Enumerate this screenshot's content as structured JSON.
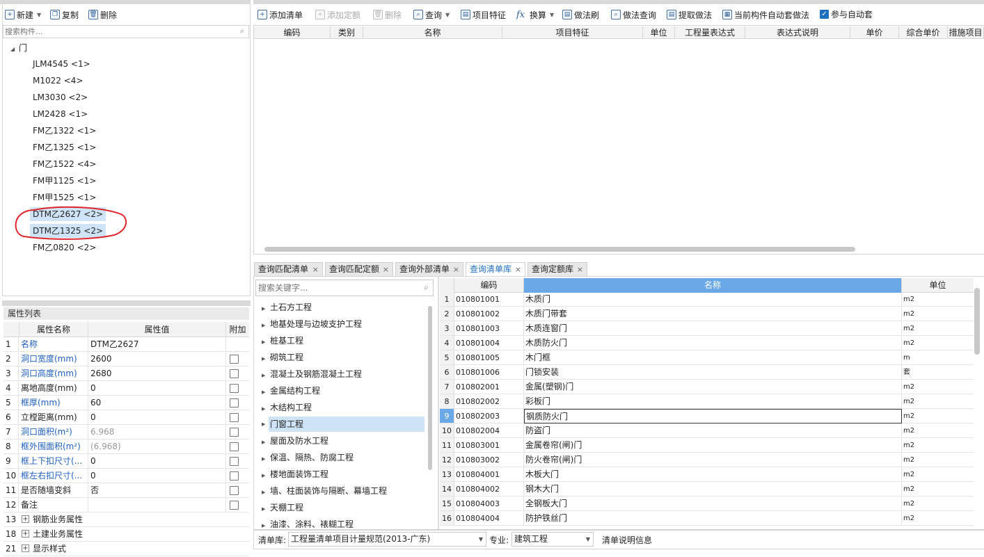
{
  "left_toolbar": {
    "new": "新建",
    "copy": "复制",
    "delete": "删除"
  },
  "search_component": {
    "placeholder": "搜索构件..."
  },
  "tree": {
    "root": "门",
    "items": [
      "JLM4545 <1>",
      "M1022 <4>",
      "LM3030 <2>",
      "LM2428 <1>",
      "FM乙1322 <1>",
      "FM乙1325 <1>",
      "FM乙1522 <4>",
      "FM甲1125 <1>",
      "FM甲1525 <1>",
      "DTM乙2627 <2>",
      "DTM乙1325 <2>",
      "FM乙0820 <2>"
    ]
  },
  "props": {
    "title": "属性列表",
    "headers": [
      "属性名称",
      "属性值",
      "附加"
    ],
    "rows": [
      {
        "n": "1",
        "name": "名称",
        "val": "DTM乙2627"
      },
      {
        "n": "2",
        "name": "洞口宽度(mm)",
        "val": "2600"
      },
      {
        "n": "3",
        "name": "洞口高度(mm)",
        "val": "2680"
      },
      {
        "n": "4",
        "name": "离地高度(mm)",
        "val": "0"
      },
      {
        "n": "5",
        "name": "框厚(mm)",
        "val": "60"
      },
      {
        "n": "6",
        "name": "立樘距离(mm)",
        "val": "0"
      },
      {
        "n": "7",
        "name": "洞口面积(m²)",
        "val": "6.968"
      },
      {
        "n": "8",
        "name": "框外围面积(m²)",
        "val": "(6.968)"
      },
      {
        "n": "9",
        "name": "框上下扣尺寸(...",
        "val": "0"
      },
      {
        "n": "10",
        "name": "框左右扣尺寸(...",
        "val": "0"
      },
      {
        "n": "11",
        "name": "是否随墙变斜",
        "val": "否"
      },
      {
        "n": "12",
        "name": "备注",
        "val": ""
      },
      {
        "n": "13",
        "name": "钢筋业务属性",
        "val": ""
      },
      {
        "n": "18",
        "name": "土建业务属性",
        "val": ""
      },
      {
        "n": "21",
        "name": "显示样式",
        "val": ""
      }
    ]
  },
  "right_toolbar": {
    "add_list": "添加清单",
    "add_quota": "添加定额",
    "delete": "删除",
    "query": "查询",
    "item_feature": "项目特征",
    "convert": "换算",
    "method_brush": "做法刷",
    "method_query": "做法查询",
    "extract_method": "提取做法",
    "auto_apply": "当前构件自动套做法",
    "join_auto": "参与自动套"
  },
  "main_grid": {
    "headers": [
      "编码",
      "类别",
      "名称",
      "项目特征",
      "单位",
      "工程量表达式",
      "表达式说明",
      "单价",
      "综合单价",
      "措施项目"
    ]
  },
  "tabs": [
    "查询匹配清单",
    "查询匹配定额",
    "查询外部清单",
    "查询清单库",
    "查询定额库"
  ],
  "search_keyword": {
    "placeholder": "搜索关键字..."
  },
  "categories": [
    "土石方工程",
    "地基处理与边坡支护工程",
    "桩基工程",
    "砌筑工程",
    "混凝土及钢筋混凝土工程",
    "金属结构工程",
    "木结构工程",
    "门窗工程",
    "屋面及防水工程",
    "保温、隔热、防腐工程",
    "楼地面装饰工程",
    "墙、柱面装饰与隔断、幕墙工程",
    "天棚工程",
    "油漆、涂料、裱糊工程"
  ],
  "list_grid": {
    "headers": [
      "编码",
      "名称",
      "单位"
    ],
    "rows": [
      {
        "n": "1",
        "code": "010801001",
        "name": "木质门",
        "unit": "m2"
      },
      {
        "n": "2",
        "code": "010801002",
        "name": "木质门带套",
        "unit": "m2"
      },
      {
        "n": "3",
        "code": "010801003",
        "name": "木质连窗门",
        "unit": "m2"
      },
      {
        "n": "4",
        "code": "010801004",
        "name": "木质防火门",
        "unit": "m2"
      },
      {
        "n": "5",
        "code": "010801005",
        "name": "木门框",
        "unit": "m"
      },
      {
        "n": "6",
        "code": "010801006",
        "name": "门锁安装",
        "unit": "套"
      },
      {
        "n": "7",
        "code": "010802001",
        "name": "金属(塑钢)门",
        "unit": "m2"
      },
      {
        "n": "8",
        "code": "010802002",
        "name": "彩板门",
        "unit": "m2"
      },
      {
        "n": "9",
        "code": "010802003",
        "name": "钢质防火门",
        "unit": "m2"
      },
      {
        "n": "10",
        "code": "010802004",
        "name": "防盗门",
        "unit": "m2"
      },
      {
        "n": "11",
        "code": "010803001",
        "name": "金属卷帘(闸)门",
        "unit": "m2"
      },
      {
        "n": "12",
        "code": "010803002",
        "name": "防火卷帘(闸)门",
        "unit": "m2"
      },
      {
        "n": "13",
        "code": "010804001",
        "name": "木板大门",
        "unit": "m2"
      },
      {
        "n": "14",
        "code": "010804002",
        "name": "钢木大门",
        "unit": "m2"
      },
      {
        "n": "15",
        "code": "010804003",
        "name": "全钢板大门",
        "unit": "m2"
      },
      {
        "n": "16",
        "code": "010804004",
        "name": "防护铁丝门",
        "unit": "m2"
      }
    ]
  },
  "footer": {
    "lib_label": "清单库:",
    "lib_value": "工程量清单项目计量规范(2013-广东)",
    "major_label": "专业:",
    "major_value": "建筑工程",
    "info": "清单说明信息"
  },
  "colors": {
    "accent": "#1f6fbf",
    "selected_bg": "#cfe3f7",
    "annotation_circle": "#e0242b"
  }
}
